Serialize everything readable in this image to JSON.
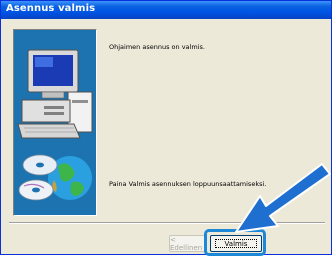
{
  "window": {
    "title": "Asennus valmis"
  },
  "content": {
    "message_top": "Ohjaimen asennus on valmis.",
    "message_bottom": "Paina Valmis asennuksen loppuunsaattamiseksi."
  },
  "buttons": {
    "back_label": "< Edellinen",
    "finish_label": "Valmis"
  },
  "icons": {
    "panel_illustration": "computer-and-globe-icon",
    "pointer_arrow": "arrow-icon"
  },
  "colors": {
    "title_bar": "#0055e5",
    "panel_background": "#1d73b0",
    "highlight": "#1e88d8",
    "arrow": "#1e6fd0"
  }
}
